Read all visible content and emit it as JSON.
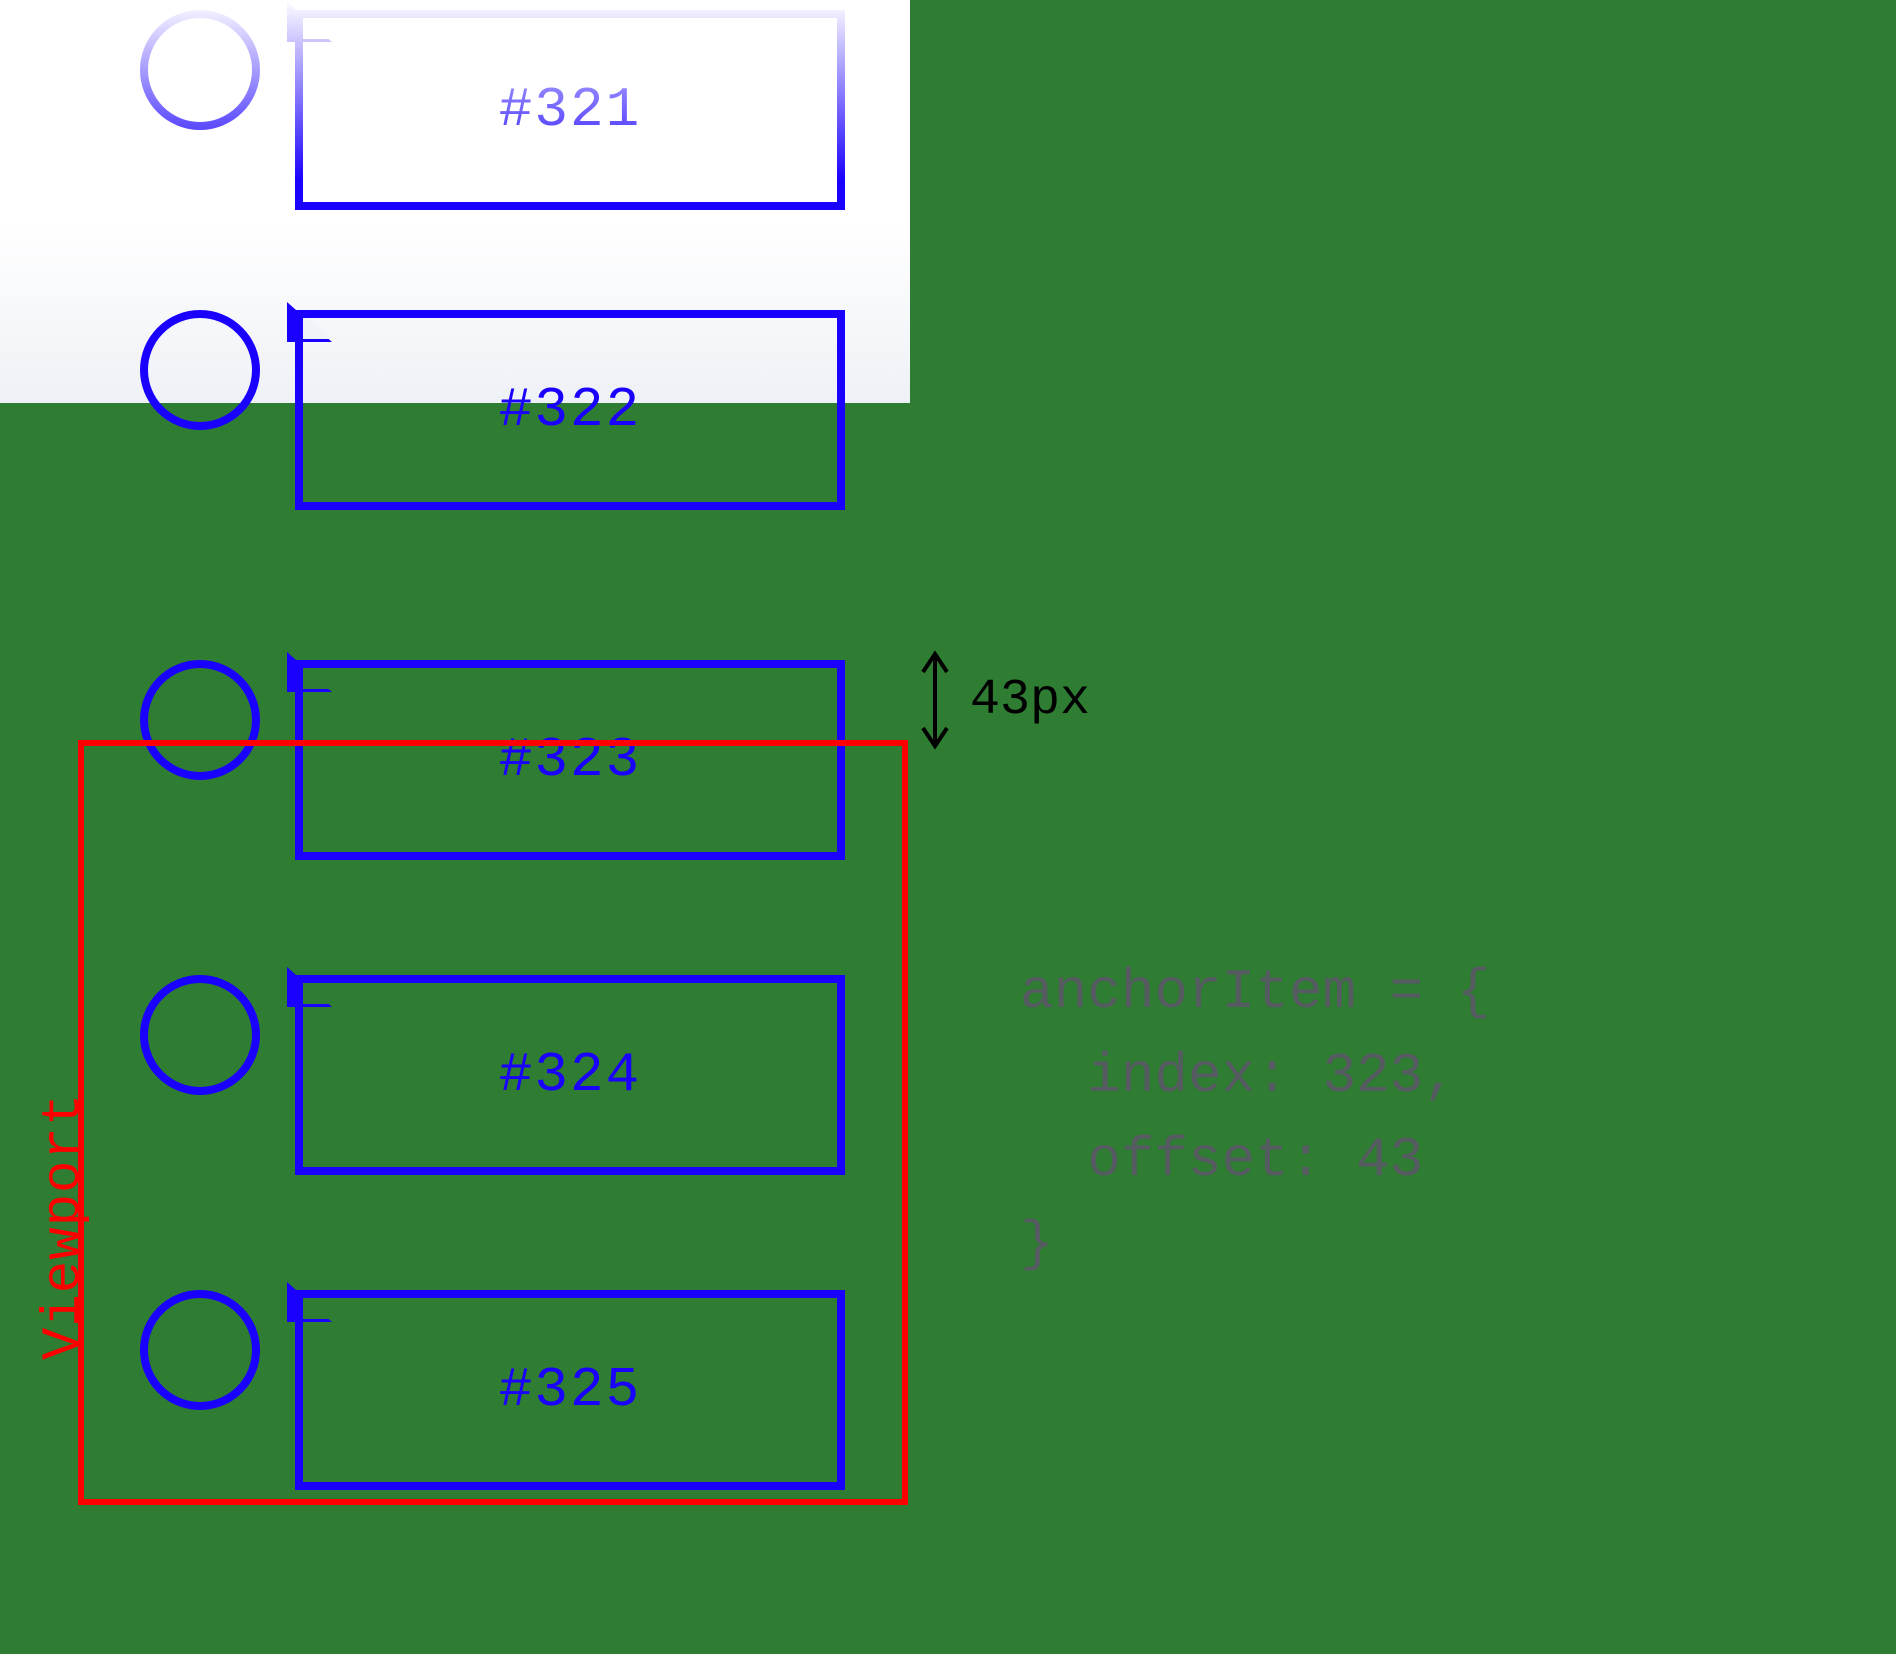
{
  "items": [
    {
      "id": "#321"
    },
    {
      "id": "#322"
    },
    {
      "id": "#323"
    },
    {
      "id": "#324"
    },
    {
      "id": "#325"
    }
  ],
  "viewport": {
    "label": "Viewport"
  },
  "measurement": {
    "value_label": "43px"
  },
  "code": {
    "line1": "anchorItem = {",
    "line2": "  index: 323,",
    "line3": "  offset: 43",
    "line4": "}"
  }
}
